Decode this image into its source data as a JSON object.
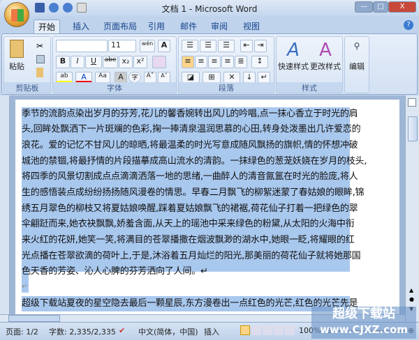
{
  "window": {
    "title": "文档 1 - Microsoft Word",
    "minimize": "—",
    "maximize": "□",
    "close": "X"
  },
  "tabs": [
    "开始",
    "插入",
    "页面布局",
    "引用",
    "邮件",
    "审阅",
    "视图"
  ],
  "ribbon": {
    "clipboard": {
      "label": "剪贴板",
      "paste": "粘贴"
    },
    "font": {
      "label": "字体",
      "font_name": "",
      "font_size": "11",
      "bold": "B",
      "italic": "I",
      "underline": "U",
      "strike": "abe",
      "sub": "x₂",
      "sup": "x²",
      "highlight": "ab",
      "color": "A",
      "case": "Aa",
      "shade": "A",
      "enclose": "字",
      "grow": "A˄",
      "shrink": "A˅",
      "phonetic": "wén",
      "border": "A"
    },
    "paragraph": {
      "label": "段落"
    },
    "styles": {
      "label": "样式",
      "quick": "快速样式",
      "change": "更改样式"
    },
    "editing": {
      "label": "编辑"
    }
  },
  "document": {
    "lines": [
      "季节的流韵点染出岁月的芬芳,花儿的馨香婉转出风儿的吟唱,点一抹心香立于时光的肩",
      "头,回眸处飘洒下一片斑斓的色彩,掬一捧清泉温润思慕的心田,转身处泼墨出几许爱恋的",
      "浪花。爱的记忆不甘风儿的晾晒,将最温柔的时光写意成随风飘扬的旗帜,情的怀想冲破",
      "城池的禁锢,将最抒情的片段描摹成高山流水的清韵。一抹绿色的葱茏妖娆在岁月的枝头,",
      "将四季的风景切割成点点滴滴洒落一地的思绪,一曲醉人的清音氤氲在时光的脸庞,将人",
      "生的感悟装点成纷纷扬扬随风漫卷的情思。早春二月飘飞的柳絮迷蒙了春姑娘的眼眸,锦",
      "绣五月翠色的柳枝又将夏姑娘唤醒,踩着夏姑娘飘飞的裙裾,荷花仙子打着一把绿色的翠",
      "伞翩跹而来,她衣袂飘飘,娇羞含面,从天上的瑶池中采来绿色的粉黛,从太阳的火海中衔",
      "来火红的花妍,她笑一笑,将满目的苍翠播撒在烟波飘渺的湖水中,她眼一眨,将耀眼的红",
      "光点播在苍翠欲滴的荷叶上,于是,沐浴着五月灿烂的阳光,那美丽的荷花仙子就将她那国",
      "色天香的芳姿、沁人心脾的芬芳洒向了人间。↵",
      "↵",
      "超级下载站夏夜的星空隐去最后一颗星辰,东方漫卷出一点红色的光芒,红色的光芒先是"
    ]
  },
  "status": {
    "page": "页面: 1/2",
    "words": "字数: 2,335/2,335",
    "language": "中文(简体，中国)",
    "mode": "插入",
    "zoom": "100%"
  },
  "watermark": {
    "line1": "超级下载站",
    "line2": "www.CJXZ.com"
  }
}
